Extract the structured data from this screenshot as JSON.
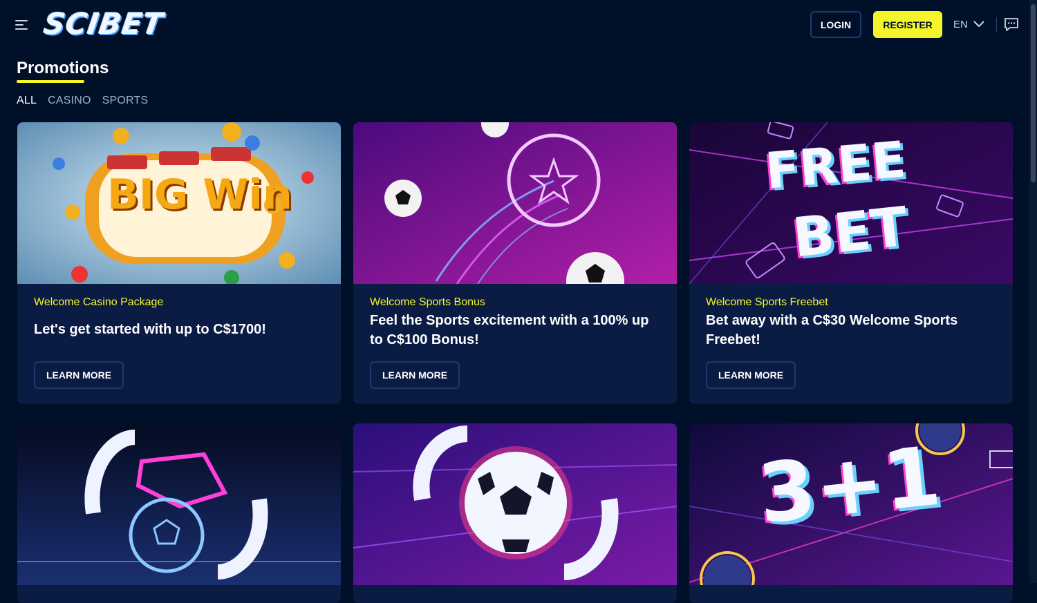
{
  "header": {
    "logo_text": "SCIBET",
    "login_label": "LOGIN",
    "register_label": "REGISTER",
    "language": "EN",
    "colors": {
      "background": "#001029",
      "accent": "#f5f52b",
      "card": "#0a1b44"
    }
  },
  "page": {
    "title": "Promotions",
    "tabs": [
      {
        "label": "ALL",
        "active": true
      },
      {
        "label": "CASINO",
        "active": false
      },
      {
        "label": "SPORTS",
        "active": false
      }
    ]
  },
  "promotions": [
    {
      "image": "big-win-slot-machine",
      "image_text": "BIG Win",
      "category": "Welcome Casino Package",
      "headline": "Let's get started with up to C$1700!",
      "button": "LEARN MORE"
    },
    {
      "image": "neon-soccer-ball",
      "category": "Welcome Sports Bonus",
      "headline": "Feel the Sports excitement with a 100% up to C$100 Bonus!",
      "button": "LEARN MORE"
    },
    {
      "image": "free-bet-neon",
      "image_text_1": "FREE",
      "image_text_2": "BET",
      "category": "Welcome Sports Freebet",
      "headline": "Bet away with a C$30 Welcome Sports Freebet!",
      "button": "LEARN MORE"
    },
    {
      "image": "neon-boot-and-ball"
    },
    {
      "image": "soccer-ball-refresh"
    },
    {
      "image": "three-plus-one",
      "image_text": "3+1"
    }
  ]
}
